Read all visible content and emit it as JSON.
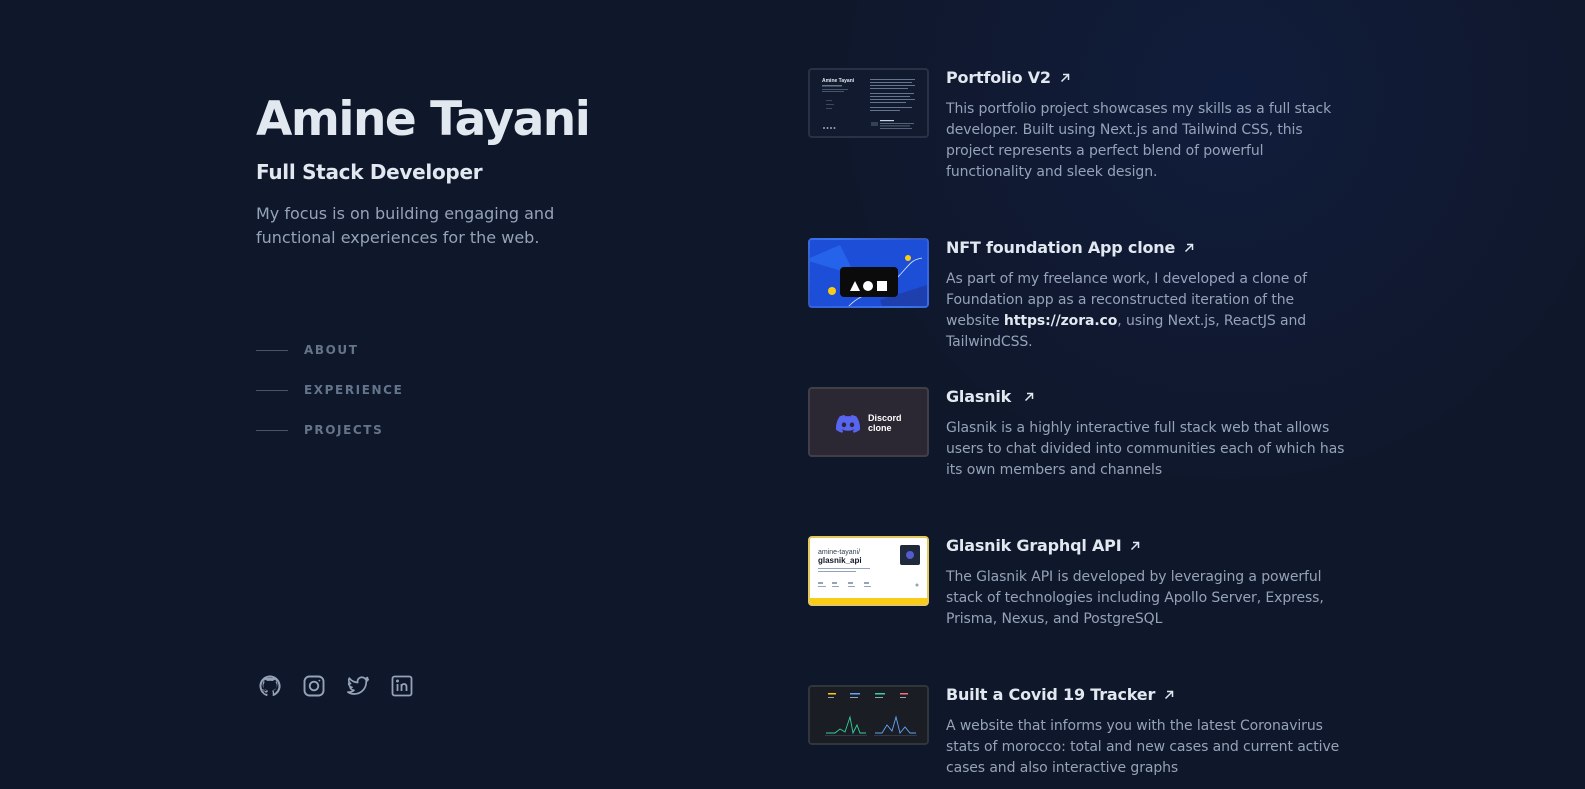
{
  "profile": {
    "name": "Amine Tayani",
    "role": "Full Stack Developer",
    "tagline": "My focus is on building engaging and functional experiences for the web."
  },
  "nav": {
    "items": [
      {
        "label": "ABOUT"
      },
      {
        "label": "EXPERIENCE"
      },
      {
        "label": "PROJECTS"
      }
    ]
  },
  "socials": [
    {
      "icon": "github-icon"
    },
    {
      "icon": "instagram-icon"
    },
    {
      "icon": "twitter-icon"
    },
    {
      "icon": "linkedin-icon"
    }
  ],
  "projects": [
    {
      "title": "Portfolio V2",
      "description": "This portfolio project showcases my skills as a full stack developer. Built using Next.js and Tailwind CSS, this project represents a perfect blend of powerful functionality and sleek design.",
      "thumb": {
        "heading": "Amine Tayani"
      }
    },
    {
      "title": "NFT foundation App clone",
      "description_before": "As part of my freelance work, I developed a clone of Foundation app as a reconstructed iteration of the website ",
      "description_link": "https://zora.co",
      "description_after": ", using Next.js, ReactJS and TailwindCSS."
    },
    {
      "title": "Glasnik",
      "description": "Glasnik is a highly interactive full stack web that allows users to chat divided into communities each of which has its own members and channels",
      "thumb": {
        "line1": "Discord",
        "line2": "clone"
      }
    },
    {
      "title": "Glasnik Graphql API",
      "description": "The Glasnik API is developed by leveraging a powerful stack of technologies including Apollo Server, Express, Prisma, Nexus, and PostgreSQL",
      "thumb": {
        "line1": "amine-tayani/",
        "line2": "glasnik_api"
      }
    },
    {
      "title": "Built a Covid 19 Tracker",
      "description": "A website that informs you with the latest Coronavirus stats of morocco: total and new cases and current active cases and also interactive graphs"
    }
  ],
  "colors": {
    "background": "#0f172a",
    "heading": "#e2e8f0",
    "body": "#94a3b8",
    "muted": "#64748b",
    "accent": "#1d4ed8"
  }
}
